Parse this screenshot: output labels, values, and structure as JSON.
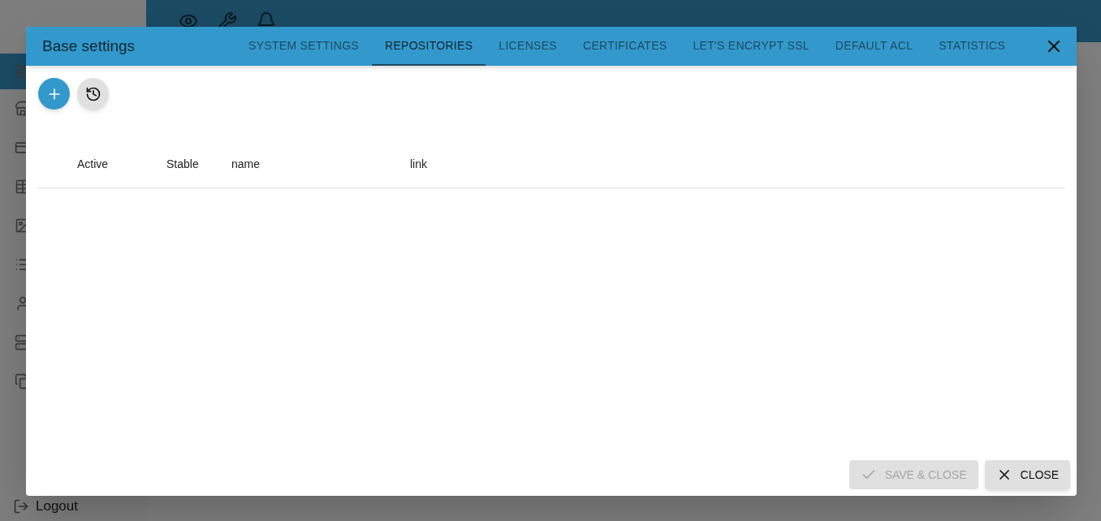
{
  "sidebar": {
    "logout": "Logout"
  },
  "dialog": {
    "title": "Base settings",
    "tabs": [
      {
        "label": "SYSTEM SETTINGS",
        "selected": false
      },
      {
        "label": "REPOSITORIES",
        "selected": true
      },
      {
        "label": "LICENSES",
        "selected": false
      },
      {
        "label": "CERTIFICATES",
        "selected": false
      },
      {
        "label": "LET'S ENCRYPT SSL",
        "selected": false
      },
      {
        "label": "DEFAULT ACL",
        "selected": false
      },
      {
        "label": "STATISTICS",
        "selected": false
      }
    ],
    "table": {
      "columns": [
        "Active",
        "Stable",
        "name",
        "link"
      ]
    },
    "buttons": [
      {
        "kind": "save",
        "label": "SAVE & CLOSE",
        "disabled": true
      },
      {
        "kind": "close",
        "label": "CLOSE",
        "disabled": false
      }
    ]
  }
}
